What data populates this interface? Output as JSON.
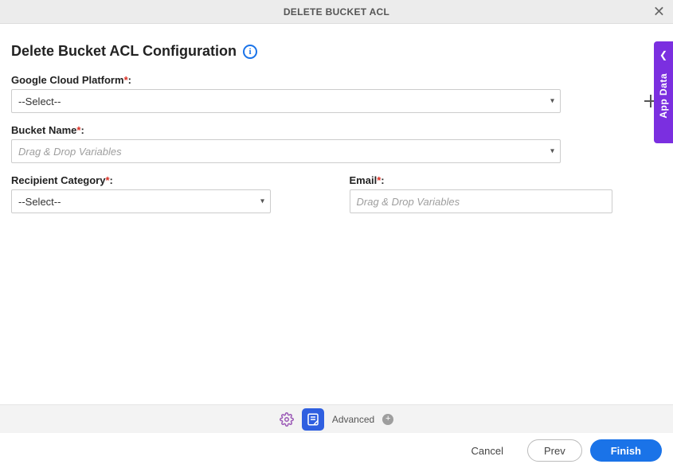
{
  "header": {
    "title": "DELETE BUCKET ACL"
  },
  "page": {
    "title": "Delete Bucket ACL Configuration"
  },
  "sideTab": {
    "label": "App Data"
  },
  "fields": {
    "gcp": {
      "label": "Google Cloud Platform",
      "selected": "--Select--"
    },
    "bucket": {
      "label": "Bucket Name",
      "placeholder": "Drag & Drop Variables"
    },
    "recipient": {
      "label": "Recipient Category",
      "selected": "--Select--"
    },
    "email": {
      "label": "Email",
      "placeholder": "Drag & Drop Variables"
    }
  },
  "toolbar": {
    "advanced": "Advanced"
  },
  "footer": {
    "cancel": "Cancel",
    "prev": "Prev",
    "finish": "Finish"
  }
}
